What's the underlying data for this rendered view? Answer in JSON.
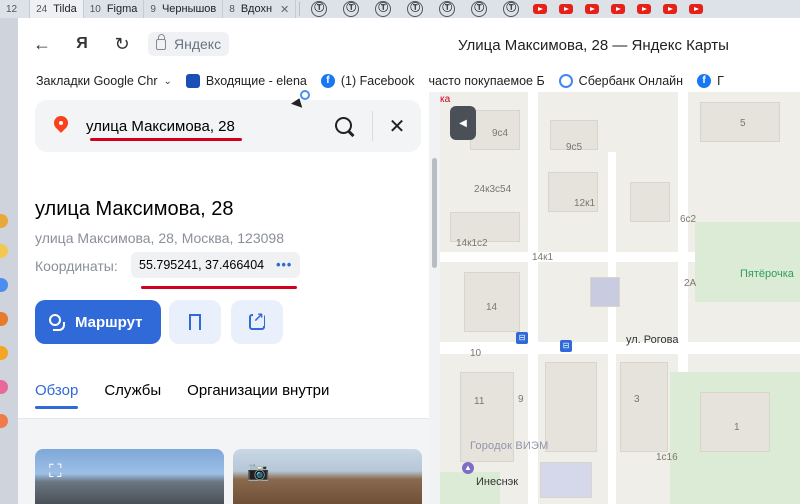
{
  "tabs": [
    {
      "num": "12",
      "label": ""
    },
    {
      "num": "24",
      "label": "Tilda",
      "active": true
    },
    {
      "num": "10",
      "label": "Figma"
    },
    {
      "num": "9",
      "label": "Чернышов"
    },
    {
      "num": "8",
      "label": "Вдохн"
    }
  ],
  "tab_close": "✕",
  "pinned_t_icon": "Ⓣ",
  "toolbar": {
    "address": "Яндекс",
    "page_title": "Улица Максимова, 28 — Яндекс Карты",
    "back_glyph": "←",
    "yandex_glyph": "Я",
    "reload_glyph": "↻"
  },
  "bookmarks": [
    {
      "label": "Закладки Google Chr",
      "icon": "folder",
      "chevron": "⌄"
    },
    {
      "label": "Входящие - elena",
      "icon": "mail"
    },
    {
      "label": "(1) Facebook",
      "icon": "facebook"
    },
    {
      "label": "часто покупаемое Б",
      "icon": "none"
    },
    {
      "label": "Сбербанк Онлайн",
      "icon": "google"
    },
    {
      "label": "Г",
      "icon": "facebook"
    }
  ],
  "search": {
    "value": "улица Максимова, 28"
  },
  "place": {
    "title": "улица Максимова, 28",
    "subtitle": "улица Максимова, 28, Москва, 123098",
    "coords_label": "Координаты:",
    "coords_value": "55.795241, 37.466404",
    "coords_more": "•••"
  },
  "actions": {
    "route_label": "Маршрут"
  },
  "info_tabs": [
    {
      "label": "Обзор",
      "active": true
    },
    {
      "label": "Службы"
    },
    {
      "label": "Организации внутри"
    }
  ],
  "map": {
    "collapse_glyph": "◀",
    "top_red_text": "ка",
    "building_labels": [
      "5",
      "9с4",
      "9с5",
      "24к3с54",
      "12к1",
      "6с2",
      "14к1с2",
      "14к1",
      "2А",
      "14",
      "10",
      "11",
      "9",
      "3",
      "1",
      "1с16"
    ],
    "street": "ул. Рогова",
    "poi": "Пятёрочка",
    "district": "Городок ВИЭМ",
    "bottom_label": "Инеснэк"
  },
  "colors": {
    "accent": "#2f6ad8",
    "brand_red": "#fc3f1d",
    "annotation_red": "#d1001f"
  }
}
